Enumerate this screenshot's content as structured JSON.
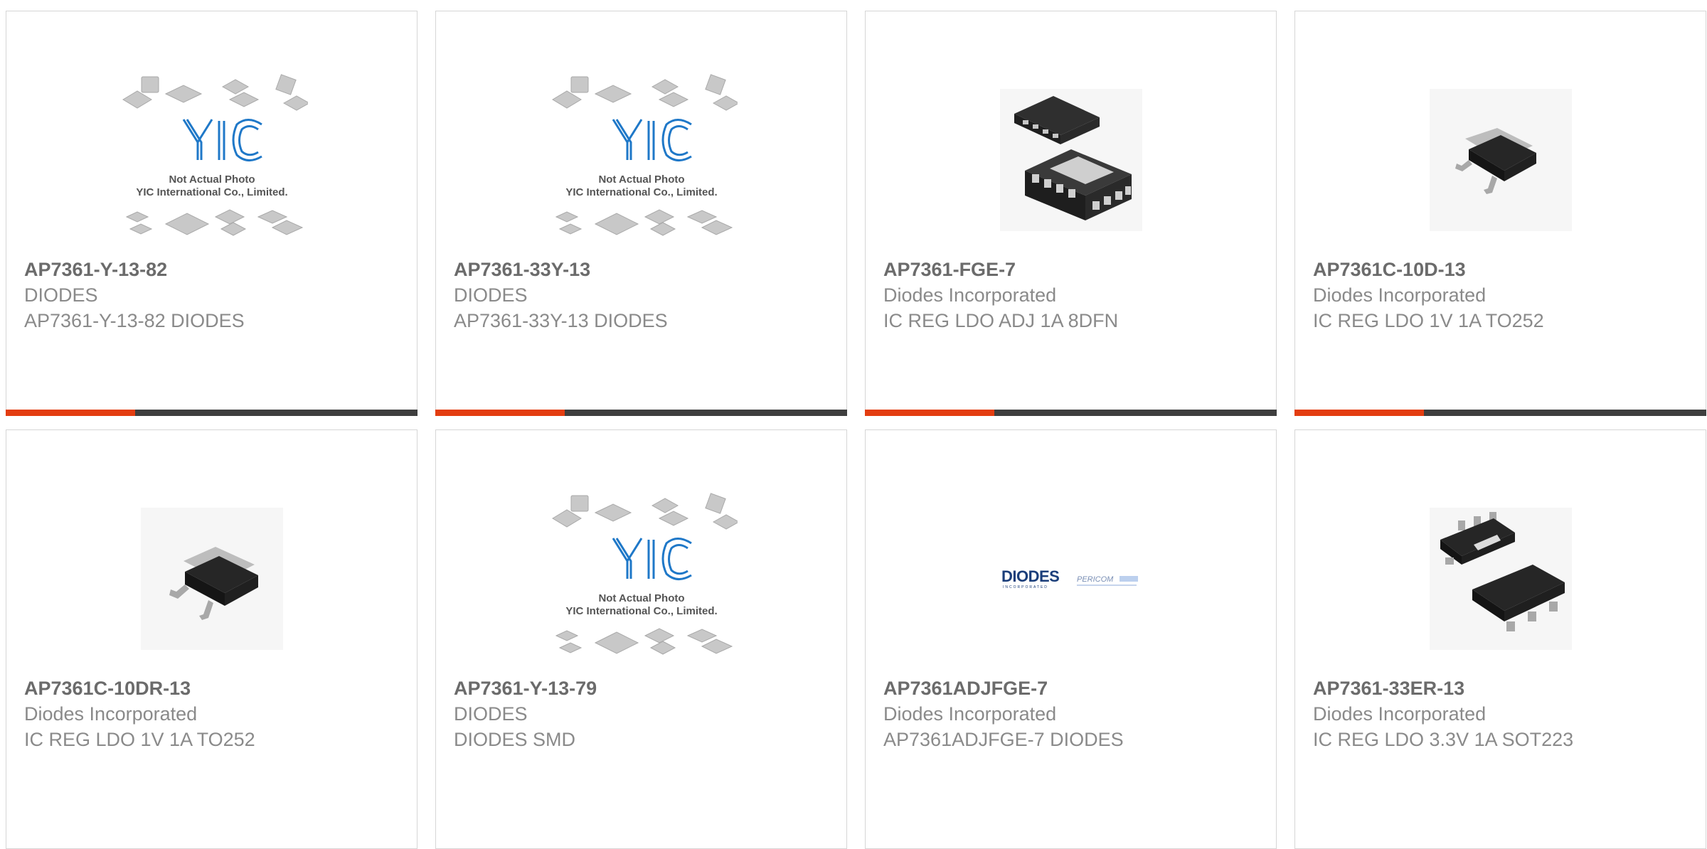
{
  "colors": {
    "accent": "#e33d10",
    "bar": "#3e3e3e",
    "title": "#6b6b6b",
    "text": "#8a8a8a",
    "border": "#d6d6d6"
  },
  "placeholder": {
    "line1": "Not Actual Photo",
    "line2": "YIC International Co., Limited.",
    "logo": "YIC"
  },
  "cards": [
    {
      "part": "AP7361-Y-13-82",
      "maker": "DIODES",
      "desc": "AP7361-Y-13-82 DIODES",
      "image": "placeholder-yic"
    },
    {
      "part": "AP7361-33Y-13",
      "maker": "DIODES",
      "desc": "AP7361-33Y-13 DIODES",
      "image": "placeholder-yic"
    },
    {
      "part": "AP7361-FGE-7",
      "maker": "Diodes Incorporated",
      "desc": "IC REG LDO ADJ 1A 8DFN",
      "image": "dfn8-package"
    },
    {
      "part": "AP7361C-10D-13",
      "maker": "Diodes Incorporated",
      "desc": "IC REG LDO 1V 1A TO252",
      "image": "to252-package"
    },
    {
      "part": "AP7361C-10DR-13",
      "maker": "Diodes Incorporated",
      "desc": "IC REG LDO 1V 1A TO252",
      "image": "to252-package"
    },
    {
      "part": "AP7361-Y-13-79",
      "maker": "DIODES",
      "desc": "DIODES SMD",
      "image": "placeholder-yic"
    },
    {
      "part": "AP7361ADJFGE-7",
      "maker": "Diodes Incorporated",
      "desc": "AP7361ADJFGE-7 DIODES",
      "image": "diodes-pericom-logo"
    },
    {
      "part": "AP7361-33ER-13",
      "maker": "Diodes Incorporated",
      "desc": "IC REG LDO 3.3V 1A SOT223",
      "image": "sot223-package"
    }
  ],
  "logos": {
    "diodes": "DIODES",
    "diodes_sub": "INCORPORATED",
    "pericom": "PERICOM"
  }
}
